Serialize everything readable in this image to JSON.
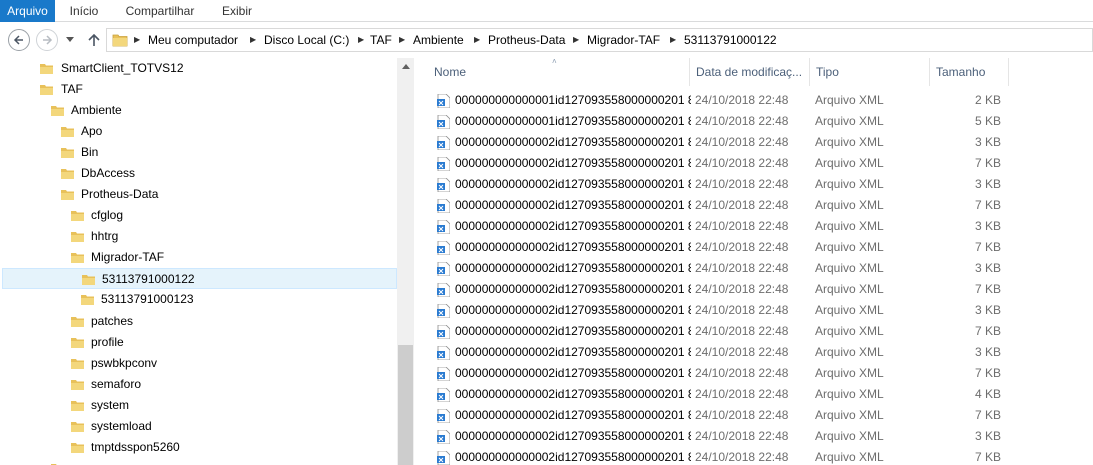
{
  "ribbon": {
    "tabs": [
      "Arquivo",
      "Início",
      "Compartilhar",
      "Exibir"
    ]
  },
  "address": {
    "segments": [
      "Meu computador",
      "Disco Local (C:)",
      "TAF",
      "Ambiente",
      "Protheus-Data",
      "Migrador-TAF",
      "53113791000122"
    ]
  },
  "tree": {
    "items": [
      {
        "label": "SmartClient_TOTVS12"
      },
      {
        "label": "TAF"
      },
      {
        "label": "Ambiente"
      },
      {
        "label": "Apo"
      },
      {
        "label": "Bin"
      },
      {
        "label": "DbAccess"
      },
      {
        "label": "Protheus-Data"
      },
      {
        "label": "cfglog"
      },
      {
        "label": "hhtrg"
      },
      {
        "label": "Migrador-TAF"
      },
      {
        "label": "53113791000122"
      },
      {
        "label": "53113791000123"
      },
      {
        "label": "patches"
      },
      {
        "label": "profile"
      },
      {
        "label": "pswbkpconv"
      },
      {
        "label": "semaforo"
      },
      {
        "label": "system"
      },
      {
        "label": "systemload"
      },
      {
        "label": "tmptdsspon5260"
      }
    ]
  },
  "columns": {
    "name": "Nome",
    "date": "Data de modificaç...",
    "type": "Tipo",
    "size": "Tamanho"
  },
  "files": [
    {
      "name": "000000000000001id127093558000000201 8...",
      "date": "24/10/2018 22:48",
      "type": "Arquivo XML",
      "size": "2 KB"
    },
    {
      "name": "000000000000001id127093558000000201 8...",
      "date": "24/10/2018 22:48",
      "type": "Arquivo XML",
      "size": "5 KB"
    },
    {
      "name": "000000000000002id127093558000000201 8...",
      "date": "24/10/2018 22:48",
      "type": "Arquivo XML",
      "size": "3 KB"
    },
    {
      "name": "000000000000002id127093558000000201 8...",
      "date": "24/10/2018 22:48",
      "type": "Arquivo XML",
      "size": "7 KB"
    },
    {
      "name": "000000000000002id127093558000000201 8...",
      "date": "24/10/2018 22:48",
      "type": "Arquivo XML",
      "size": "3 KB"
    },
    {
      "name": "000000000000002id127093558000000201 8...",
      "date": "24/10/2018 22:48",
      "type": "Arquivo XML",
      "size": "7 KB"
    },
    {
      "name": "000000000000002id127093558000000201 8...",
      "date": "24/10/2018 22:48",
      "type": "Arquivo XML",
      "size": "3 KB"
    },
    {
      "name": "000000000000002id127093558000000201 8...",
      "date": "24/10/2018 22:48",
      "type": "Arquivo XML",
      "size": "7 KB"
    },
    {
      "name": "000000000000002id127093558000000201 8...",
      "date": "24/10/2018 22:48",
      "type": "Arquivo XML",
      "size": "3 KB"
    },
    {
      "name": "000000000000002id127093558000000201 8...",
      "date": "24/10/2018 22:48",
      "type": "Arquivo XML",
      "size": "7 KB"
    },
    {
      "name": "000000000000002id127093558000000201 8...",
      "date": "24/10/2018 22:48",
      "type": "Arquivo XML",
      "size": "3 KB"
    },
    {
      "name": "000000000000002id127093558000000201 8...",
      "date": "24/10/2018 22:48",
      "type": "Arquivo XML",
      "size": "7 KB"
    },
    {
      "name": "000000000000002id127093558000000201 8...",
      "date": "24/10/2018 22:48",
      "type": "Arquivo XML",
      "size": "3 KB"
    },
    {
      "name": "000000000000002id127093558000000201 8...",
      "date": "24/10/2018 22:48",
      "type": "Arquivo XML",
      "size": "7 KB"
    },
    {
      "name": "000000000000002id127093558000000201 8...",
      "date": "24/10/2018 22:48",
      "type": "Arquivo XML",
      "size": "4 KB"
    },
    {
      "name": "000000000000002id127093558000000201 8...",
      "date": "24/10/2018 22:48",
      "type": "Arquivo XML",
      "size": "7 KB"
    },
    {
      "name": "000000000000002id127093558000000201 8...",
      "date": "24/10/2018 22:48",
      "type": "Arquivo XML",
      "size": "3 KB"
    },
    {
      "name": "000000000000002id127093558000000201 8...",
      "date": "24/10/2018 22:48",
      "type": "Arquivo XML",
      "size": "7 KB"
    }
  ],
  "colors": {
    "accent": "#1979ca",
    "folder": "#e8c15a",
    "selection": "#e5f3fb"
  }
}
